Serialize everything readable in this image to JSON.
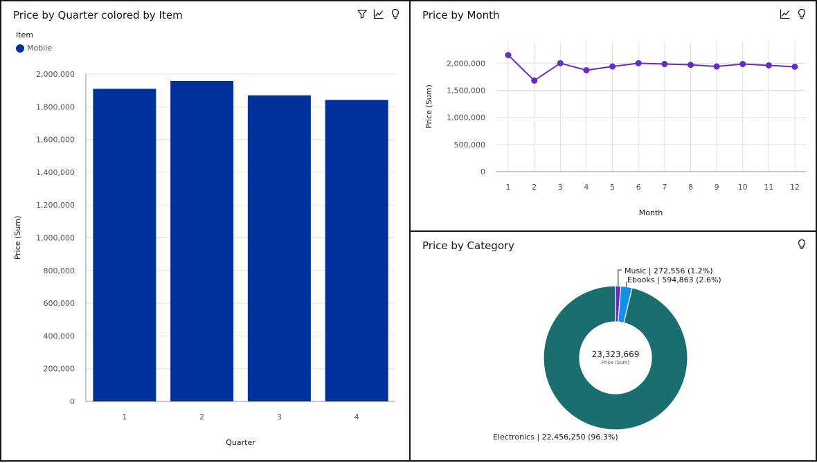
{
  "panels": {
    "quarter": {
      "title": "Price by Quarter colored by Item",
      "legend_title": "Item",
      "legend_item": "Mobile"
    },
    "month": {
      "title": "Price by Month"
    },
    "category": {
      "title": "Price by Category",
      "center_value": "23,323,669",
      "center_label": "Price (Sum)"
    }
  },
  "icons": {
    "quarter": [
      "filter-icon",
      "chart-line-icon",
      "lightbulb-icon"
    ],
    "month": [
      "chart-line-icon",
      "lightbulb-icon"
    ],
    "category": [
      "lightbulb-icon"
    ]
  },
  "colors": {
    "bar": "#00309a",
    "line": "#6929c4",
    "electronics": "#1a6e6e",
    "ebooks": "#1192e8",
    "music": "#6929c4"
  },
  "chart_data": [
    {
      "type": "bar",
      "title": "Price by Quarter colored by Item",
      "xlabel": "Quarter",
      "ylabel": "Price (Sum)",
      "categories": [
        "1",
        "2",
        "3",
        "4"
      ],
      "series": [
        {
          "name": "Mobile",
          "values": [
            1910000,
            1958000,
            1870000,
            1842000
          ]
        }
      ],
      "ylim": [
        0,
        2000000
      ],
      "yticks": [
        0,
        200000,
        400000,
        600000,
        800000,
        1000000,
        1200000,
        1400000,
        1600000,
        1800000,
        2000000
      ],
      "ytick_labels": [
        "0",
        "200,000",
        "400,000",
        "600,000",
        "800,000",
        "1,000,000",
        "1,200,000",
        "1,400,000",
        "1,600,000",
        "1,800,000",
        "2,000,000"
      ],
      "grid": true,
      "legend": "top-left"
    },
    {
      "type": "line",
      "title": "Price by Month",
      "xlabel": "Month",
      "ylabel": "Price (Sum)",
      "x": [
        "1",
        "2",
        "3",
        "4",
        "5",
        "6",
        "7",
        "8",
        "9",
        "10",
        "11",
        "12"
      ],
      "series": [
        {
          "values": [
            2150000,
            1680000,
            2000000,
            1870000,
            1940000,
            2000000,
            1985000,
            1970000,
            1940000,
            1985000,
            1960000,
            1935000
          ]
        }
      ],
      "ylim": [
        0,
        2400000
      ],
      "yticks": [
        0,
        500000,
        1000000,
        1500000,
        2000000
      ],
      "ytick_labels": [
        "0",
        "500,000",
        "1,000,000",
        "1,500,000",
        "2,000,000"
      ],
      "grid": true
    },
    {
      "type": "pie",
      "title": "Price by Category",
      "labels": [
        "Music",
        "Ebooks",
        "Electronics"
      ],
      "values": [
        272556,
        594863,
        22456250
      ],
      "percent": [
        1.2,
        2.6,
        96.3
      ],
      "data_labels": [
        "Music | 272,556 (1.2%)",
        "Ebooks | 594,863 (2.6%)",
        "Electronics | 22,456,250 (96.3%)"
      ],
      "total": "23,323,669",
      "total_label": "Price (Sum)"
    }
  ]
}
